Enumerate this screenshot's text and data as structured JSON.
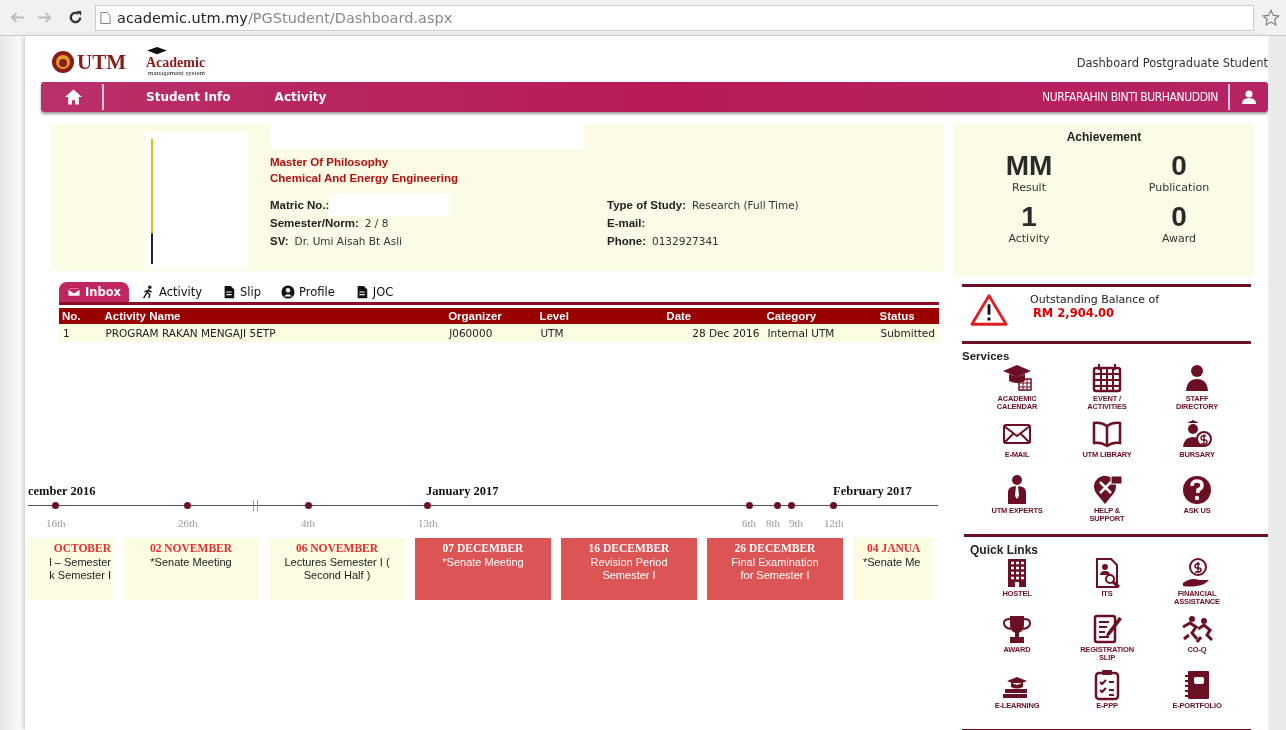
{
  "browser": {
    "url_host": "academic.utm.my",
    "url_path": "/PGStudent/Dashboard.aspx"
  },
  "header": {
    "logo": "UTM",
    "logo2": "Academic",
    "logo2_sub": "management system",
    "page_title": "Dashboard Postgraduate Student"
  },
  "nav": {
    "items": [
      "Student Info",
      "Activity"
    ],
    "user": "NURFARAHIN BINTI BURHANUDDIN"
  },
  "profile": {
    "programme": "Master Of Philosophy",
    "faculty": "Chemical And Energy Engineering",
    "fields_left": [
      {
        "label": "Matric No.:"
      },
      {
        "label": "Semester/Norm:",
        "value": "2 / 8"
      },
      {
        "label": "SV:",
        "value": "Dr. Umi Aisah Bt Asli"
      }
    ],
    "fields_right": [
      {
        "label": "Type of Study:",
        "value": "Research (Full Time)"
      },
      {
        "label": "E-mail:"
      },
      {
        "label": "Phone:",
        "value": "0132927341"
      }
    ]
  },
  "tabs": [
    {
      "label": "Inbox",
      "selected": true
    },
    {
      "label": "Activity",
      "selected": false
    },
    {
      "label": "Slip",
      "selected": false
    },
    {
      "label": "Profile",
      "selected": false
    },
    {
      "label": "JOC",
      "selected": false
    }
  ],
  "table": {
    "columns": [
      "No.",
      "Activity Name",
      "Organizer",
      "Level",
      "Date",
      "Category",
      "Status"
    ],
    "rows": [
      [
        "1",
        "PROGRAM RAKAN MENGAJI 5ETP",
        "J060000",
        "UTM",
        "28 Dec 2016",
        "Internal UTM",
        "Submitted"
      ]
    ]
  },
  "timeline": {
    "months": [
      "cember 2016",
      "January 2017",
      "February 2017"
    ],
    "ticks": [
      "16th",
      "26th",
      "4th",
      "13th",
      "6th",
      "8th",
      "9th",
      "12th"
    ],
    "events": [
      {
        "date": "OCTOBER",
        "text": "l – Semester\nk Semester I",
        "highlighted": false
      },
      {
        "date": "02 NOVEMBER",
        "text": "*Senate Meeting",
        "highlighted": false
      },
      {
        "date": "06 NOVEMBER",
        "text": "Lectures Semester I (\nSecond Half )",
        "highlighted": false
      },
      {
        "date": "07 DECEMBER",
        "text": "*Senate Meeting",
        "highlighted": true
      },
      {
        "date": "16 DECEMBER",
        "text": "Revision Period\nSemester I",
        "highlighted": true
      },
      {
        "date": "26 DECEMBER",
        "text": "Final Examination\nfor Semester I",
        "highlighted": true
      },
      {
        "date": "04 JANUA",
        "text": "*Senate Me",
        "highlighted": false
      }
    ]
  },
  "achievement": {
    "title": "Achievement",
    "stats": [
      {
        "value": "MM",
        "label": "Result"
      },
      {
        "value": "0",
        "label": "Publication"
      },
      {
        "value": "1",
        "label": "Activity"
      },
      {
        "value": "0",
        "label": "Award"
      }
    ]
  },
  "balance": {
    "text": "Outstanding Balance of",
    "amount": "RM 2,904.00"
  },
  "services": {
    "title": "Services",
    "items": [
      "ACADEMIC\nCALENDAR",
      "EVENT /\nACTIVITIES",
      "STAFF\nDIRECTORY",
      "E-MAIL",
      "UTM LIBRARY",
      "BURSARY",
      "UTM EXPERTS",
      "HELP &\nSUPPORT",
      "ASK US"
    ]
  },
  "quick_links": {
    "title": "Quick Links",
    "items": [
      "HOSTEL",
      "ITS",
      "FINANCIAL\nASSISTANCE",
      "AWARD",
      "REGISTRATION\nSLIP",
      "CO-Q",
      "E-LEARNING",
      "E-PPP",
      "E-PORTFOLIO"
    ]
  }
}
